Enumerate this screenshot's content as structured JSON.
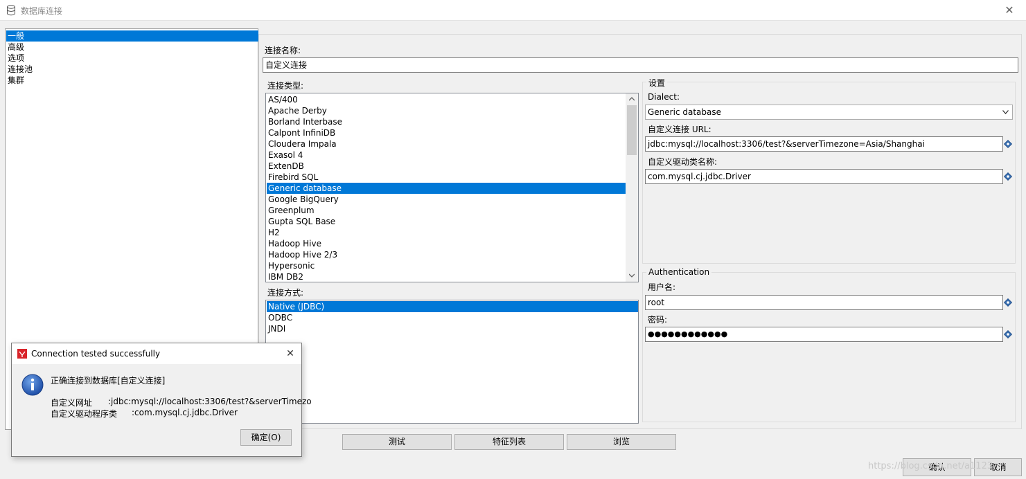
{
  "window": {
    "title": "数据库连接",
    "close_glyph": "✕"
  },
  "tree": {
    "items": [
      {
        "label": "一般",
        "selected": true
      },
      {
        "label": "高级",
        "selected": false
      },
      {
        "label": "选项",
        "selected": false
      },
      {
        "label": "连接池",
        "selected": false
      },
      {
        "label": "集群",
        "selected": false
      }
    ]
  },
  "connection": {
    "name_label": "连接名称:",
    "name_value": "自定义连接",
    "type_label": "连接类型:",
    "types": [
      {
        "label": "AS/400",
        "selected": false
      },
      {
        "label": "Apache Derby",
        "selected": false
      },
      {
        "label": "Borland Interbase",
        "selected": false
      },
      {
        "label": "Calpont InfiniDB",
        "selected": false
      },
      {
        "label": "Cloudera Impala",
        "selected": false
      },
      {
        "label": "Exasol 4",
        "selected": false
      },
      {
        "label": "ExtenDB",
        "selected": false
      },
      {
        "label": "Firebird SQL",
        "selected": false
      },
      {
        "label": "Generic database",
        "selected": true
      },
      {
        "label": "Google BigQuery",
        "selected": false
      },
      {
        "label": "Greenplum",
        "selected": false
      },
      {
        "label": "Gupta SQL Base",
        "selected": false
      },
      {
        "label": "H2",
        "selected": false
      },
      {
        "label": "Hadoop Hive",
        "selected": false
      },
      {
        "label": "Hadoop Hive 2/3",
        "selected": false
      },
      {
        "label": "Hypersonic",
        "selected": false
      },
      {
        "label": "IBM DB2",
        "selected": false
      }
    ],
    "method_label": "连接方式:",
    "methods": [
      {
        "label": "Native (JDBC)",
        "selected": true
      },
      {
        "label": "ODBC",
        "selected": false
      },
      {
        "label": "JNDI",
        "selected": false
      }
    ]
  },
  "settings": {
    "group_title": "设置",
    "dialect_label": "Dialect:",
    "dialect_value": "Generic database",
    "url_label": "自定义连接 URL:",
    "url_value": "jdbc:mysql://localhost:3306/test?&serverTimezone=Asia/Shanghai",
    "driver_label": "自定义驱动类名称:",
    "driver_value": "com.mysql.cj.jdbc.Driver"
  },
  "auth": {
    "group_title": "Authentication",
    "user_label": "用户名:",
    "user_value": "root",
    "password_label": "密码:",
    "password_value": "●●●●●●●●●●●●"
  },
  "buttons": {
    "test": "测试",
    "features": "特征列表",
    "browse": "浏览",
    "ok": "确认",
    "cancel": "取消"
  },
  "dialog": {
    "title": "Connection tested successfully",
    "message": "正确连接到数据库[自定义连接]",
    "url_key": "自定义网址",
    "url_value": ":jdbc:mysql://localhost:3306/test?&serverTimezo",
    "driver_key": "自定义驱动程序类",
    "driver_value": ":com.mysql.cj.jdbc.Driver",
    "ok_button": "确定(O)",
    "close_glyph": "✕"
  },
  "watermark": "https://blog.csdn.net/a1123..."
}
